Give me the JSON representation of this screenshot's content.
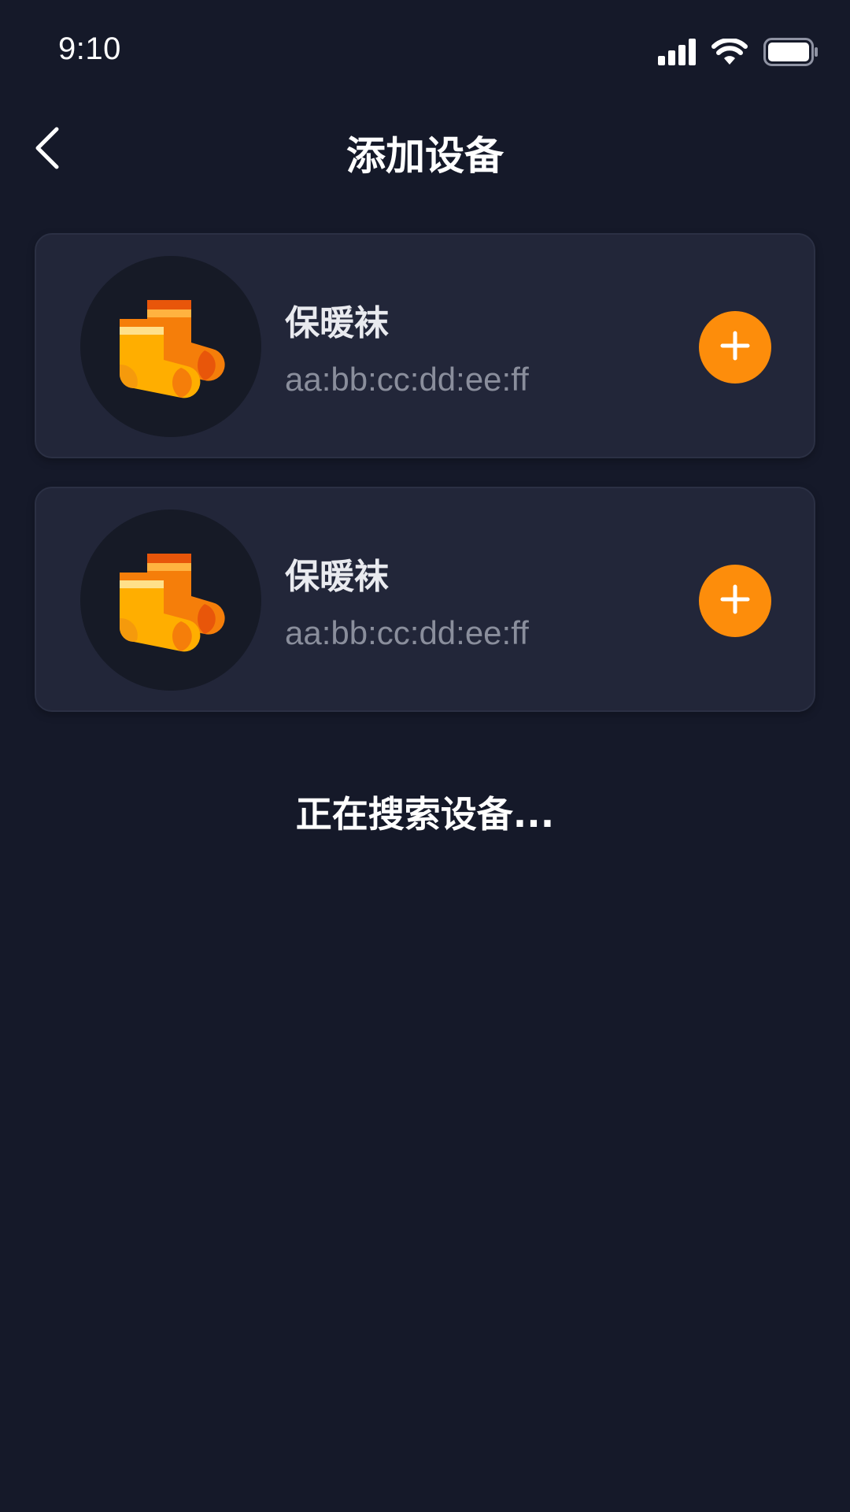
{
  "status_bar": {
    "time": "9:10",
    "icons": [
      "signal-icon",
      "wifi-icon",
      "battery-icon"
    ]
  },
  "header": {
    "title": "添加设备",
    "back_icon": "chevron-left-icon"
  },
  "devices": [
    {
      "name": "保暖袜",
      "mac": "aa:bb:cc:dd:ee:ff",
      "icon": "socks-icon",
      "action_icon": "plus-icon"
    },
    {
      "name": "保暖袜",
      "mac": "aa:bb:cc:dd:ee:ff",
      "icon": "socks-icon",
      "action_icon": "plus-icon"
    }
  ],
  "status": {
    "searching": "正在搜索设备..."
  },
  "colors": {
    "background": "#151929",
    "card": "#222639",
    "avatar": "#161a26",
    "accent": "#fd8d0b",
    "sock_yellow": "#ffae00",
    "sock_orange": "#f57e0a",
    "sock_red": "#e8560a"
  }
}
